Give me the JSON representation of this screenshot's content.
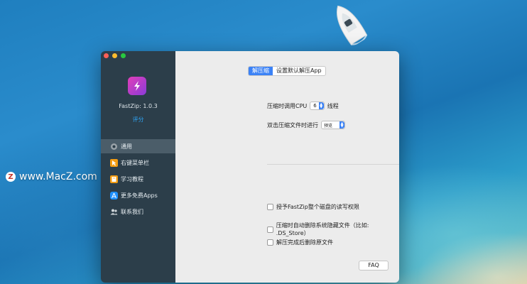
{
  "watermark": {
    "badge": "Z",
    "text": "www.MacZ.com"
  },
  "app": {
    "version": "FastZip: 1.0.3",
    "rate_label": "评分"
  },
  "sidebar": {
    "items": [
      {
        "label": "通用",
        "icon": "gear-icon",
        "color": "#8e8e93"
      },
      {
        "label": "右键菜单栏",
        "icon": "cursor-icon",
        "color": "#f39c12"
      },
      {
        "label": "学习教程",
        "icon": "book-icon",
        "color": "#f39c12"
      },
      {
        "label": "更多免费Apps",
        "icon": "app-store-icon",
        "color": "#1e90ff"
      },
      {
        "label": "联系我们",
        "icon": "people-icon",
        "color": "#bfc8ce"
      }
    ]
  },
  "tabs": [
    {
      "label": "解压缩",
      "active": true
    },
    {
      "label": "设置默认解压App",
      "active": false
    }
  ],
  "settings": {
    "cpu_label": "压缩时调用CPU",
    "cpu_value": "6",
    "cpu_suffix": "线程",
    "dblclick_label": "双击压缩文件时进行",
    "dblclick_value": "预览"
  },
  "checkboxes": [
    {
      "label": "授予FastZip整个磁盘的读写权限",
      "checked": false
    },
    {
      "label": "压缩时自动删除系统隐藏文件（比如: .DS_Store）",
      "checked": false
    },
    {
      "label": "解压完成后删除原文件",
      "checked": false
    }
  ],
  "faq_label": "FAQ",
  "colors": {
    "sidebar_bg": "#2c3e4a",
    "accent": "#3b82f6",
    "link": "#2ea3f2"
  }
}
